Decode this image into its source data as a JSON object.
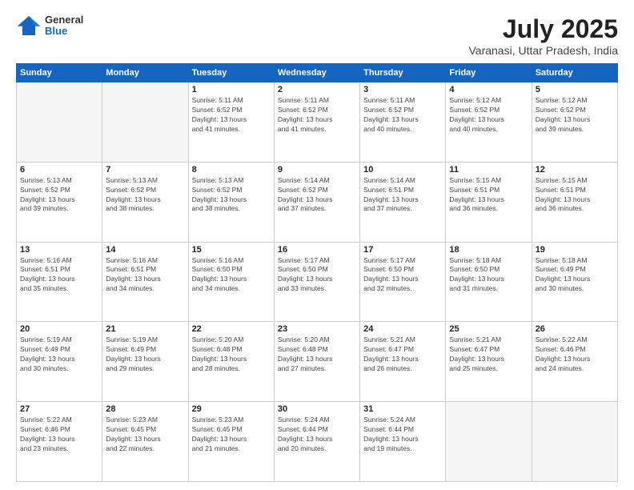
{
  "header": {
    "logo": {
      "general": "General",
      "blue": "Blue"
    },
    "title": "July 2025",
    "location": "Varanasi, Uttar Pradesh, India"
  },
  "days_of_week": [
    "Sunday",
    "Monday",
    "Tuesday",
    "Wednesday",
    "Thursday",
    "Friday",
    "Saturday"
  ],
  "weeks": [
    [
      {
        "day": "",
        "info": ""
      },
      {
        "day": "",
        "info": ""
      },
      {
        "day": "1",
        "info": "Sunrise: 5:11 AM\nSunset: 6:52 PM\nDaylight: 13 hours\nand 41 minutes."
      },
      {
        "day": "2",
        "info": "Sunrise: 5:11 AM\nSunset: 6:52 PM\nDaylight: 13 hours\nand 41 minutes."
      },
      {
        "day": "3",
        "info": "Sunrise: 5:11 AM\nSunset: 6:52 PM\nDaylight: 13 hours\nand 40 minutes."
      },
      {
        "day": "4",
        "info": "Sunrise: 5:12 AM\nSunset: 6:52 PM\nDaylight: 13 hours\nand 40 minutes."
      },
      {
        "day": "5",
        "info": "Sunrise: 5:12 AM\nSunset: 6:52 PM\nDaylight: 13 hours\nand 39 minutes."
      }
    ],
    [
      {
        "day": "6",
        "info": "Sunrise: 5:13 AM\nSunset: 6:52 PM\nDaylight: 13 hours\nand 39 minutes."
      },
      {
        "day": "7",
        "info": "Sunrise: 5:13 AM\nSunset: 6:52 PM\nDaylight: 13 hours\nand 38 minutes."
      },
      {
        "day": "8",
        "info": "Sunrise: 5:13 AM\nSunset: 6:52 PM\nDaylight: 13 hours\nand 38 minutes."
      },
      {
        "day": "9",
        "info": "Sunrise: 5:14 AM\nSunset: 6:52 PM\nDaylight: 13 hours\nand 37 minutes."
      },
      {
        "day": "10",
        "info": "Sunrise: 5:14 AM\nSunset: 6:51 PM\nDaylight: 13 hours\nand 37 minutes."
      },
      {
        "day": "11",
        "info": "Sunrise: 5:15 AM\nSunset: 6:51 PM\nDaylight: 13 hours\nand 36 minutes."
      },
      {
        "day": "12",
        "info": "Sunrise: 5:15 AM\nSunset: 6:51 PM\nDaylight: 13 hours\nand 36 minutes."
      }
    ],
    [
      {
        "day": "13",
        "info": "Sunrise: 5:16 AM\nSunset: 6:51 PM\nDaylight: 13 hours\nand 35 minutes."
      },
      {
        "day": "14",
        "info": "Sunrise: 5:16 AM\nSunset: 6:51 PM\nDaylight: 13 hours\nand 34 minutes."
      },
      {
        "day": "15",
        "info": "Sunrise: 5:16 AM\nSunset: 6:50 PM\nDaylight: 13 hours\nand 34 minutes."
      },
      {
        "day": "16",
        "info": "Sunrise: 5:17 AM\nSunset: 6:50 PM\nDaylight: 13 hours\nand 33 minutes."
      },
      {
        "day": "17",
        "info": "Sunrise: 5:17 AM\nSunset: 6:50 PM\nDaylight: 13 hours\nand 32 minutes."
      },
      {
        "day": "18",
        "info": "Sunrise: 5:18 AM\nSunset: 6:50 PM\nDaylight: 13 hours\nand 31 minutes."
      },
      {
        "day": "19",
        "info": "Sunrise: 5:18 AM\nSunset: 6:49 PM\nDaylight: 13 hours\nand 30 minutes."
      }
    ],
    [
      {
        "day": "20",
        "info": "Sunrise: 5:19 AM\nSunset: 6:49 PM\nDaylight: 13 hours\nand 30 minutes."
      },
      {
        "day": "21",
        "info": "Sunrise: 5:19 AM\nSunset: 6:49 PM\nDaylight: 13 hours\nand 29 minutes."
      },
      {
        "day": "22",
        "info": "Sunrise: 5:20 AM\nSunset: 6:48 PM\nDaylight: 13 hours\nand 28 minutes."
      },
      {
        "day": "23",
        "info": "Sunrise: 5:20 AM\nSunset: 6:48 PM\nDaylight: 13 hours\nand 27 minutes."
      },
      {
        "day": "24",
        "info": "Sunrise: 5:21 AM\nSunset: 6:47 PM\nDaylight: 13 hours\nand 26 minutes."
      },
      {
        "day": "25",
        "info": "Sunrise: 5:21 AM\nSunset: 6:47 PM\nDaylight: 13 hours\nand 25 minutes."
      },
      {
        "day": "26",
        "info": "Sunrise: 5:22 AM\nSunset: 6:46 PM\nDaylight: 13 hours\nand 24 minutes."
      }
    ],
    [
      {
        "day": "27",
        "info": "Sunrise: 5:22 AM\nSunset: 6:46 PM\nDaylight: 13 hours\nand 23 minutes."
      },
      {
        "day": "28",
        "info": "Sunrise: 5:23 AM\nSunset: 6:45 PM\nDaylight: 13 hours\nand 22 minutes."
      },
      {
        "day": "29",
        "info": "Sunrise: 5:23 AM\nSunset: 6:45 PM\nDaylight: 13 hours\nand 21 minutes."
      },
      {
        "day": "30",
        "info": "Sunrise: 5:24 AM\nSunset: 6:44 PM\nDaylight: 13 hours\nand 20 minutes."
      },
      {
        "day": "31",
        "info": "Sunrise: 5:24 AM\nSunset: 6:44 PM\nDaylight: 13 hours\nand 19 minutes."
      },
      {
        "day": "",
        "info": ""
      },
      {
        "day": "",
        "info": ""
      }
    ]
  ]
}
